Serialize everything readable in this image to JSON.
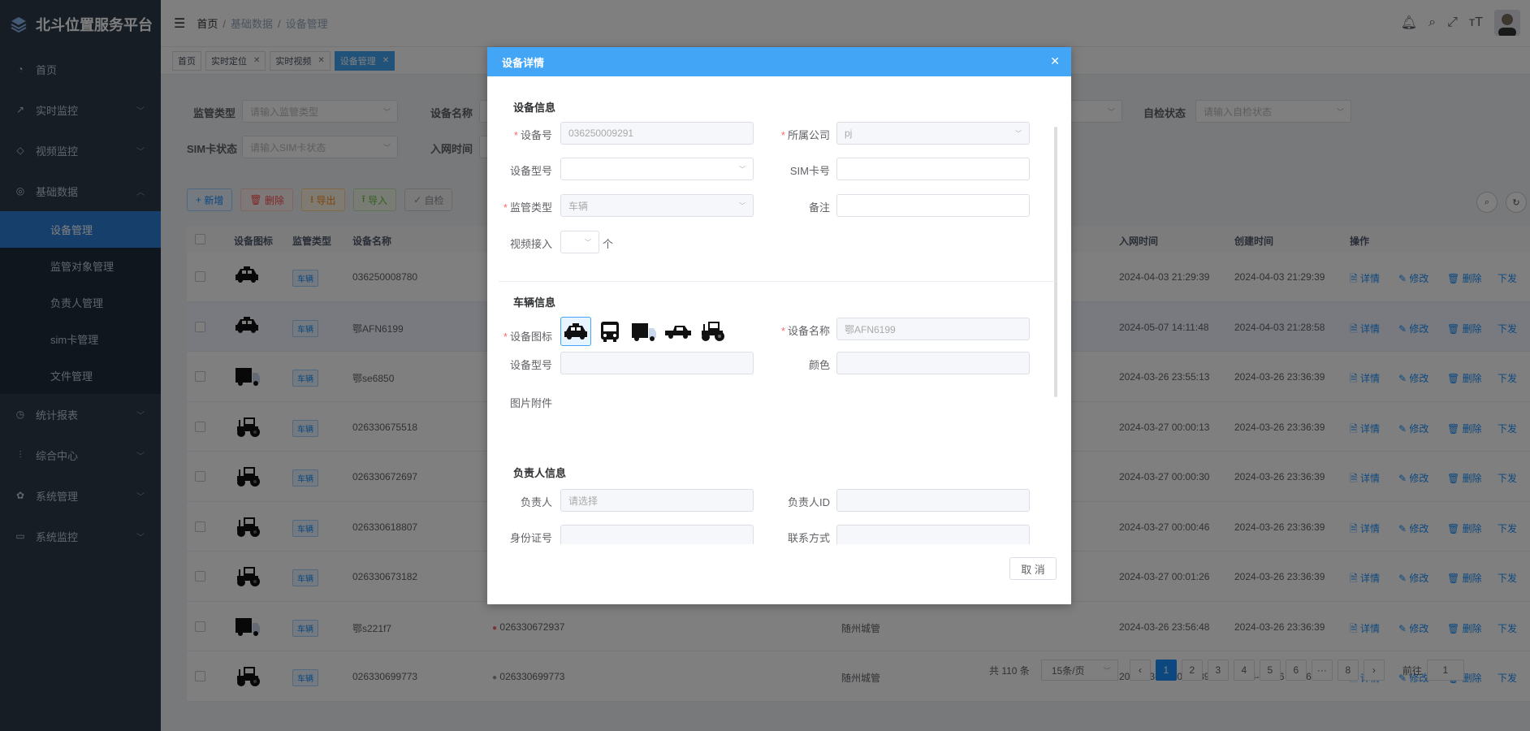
{
  "app": {
    "title": "北斗位置服务平台"
  },
  "sidebar": {
    "items": [
      {
        "label": "首页",
        "icon": "dashboard-icon"
      },
      {
        "label": "实时监控",
        "icon": "chart-line-icon"
      },
      {
        "label": "视频监控",
        "icon": "video-icon"
      },
      {
        "label": "基础数据",
        "icon": "database-icon"
      },
      {
        "label": "统计报表",
        "icon": "pie-chart-icon"
      },
      {
        "label": "综合中心",
        "icon": "sliders-icon"
      },
      {
        "label": "系统管理",
        "icon": "gear-icon"
      },
      {
        "label": "系统监控",
        "icon": "monitor-icon"
      }
    ],
    "sub_items": [
      "设备管理",
      "监管对象管理",
      "负责人管理",
      "sim卡管理",
      "文件管理"
    ]
  },
  "breadcrumb": [
    "首页",
    "基础数据",
    "设备管理"
  ],
  "tags": [
    {
      "label": "首页",
      "closable": false
    },
    {
      "label": "实时定位",
      "closable": true
    },
    {
      "label": "实时视频",
      "closable": true
    },
    {
      "label": "设备管理",
      "closable": true,
      "active": true
    }
  ],
  "filters": {
    "supervise_type_label": "监管类型",
    "supervise_type_placeholder": "请输入监管类型",
    "device_name_label": "设备名称",
    "self_check_label": "自检状态",
    "self_check_placeholder": "请输入自检状态",
    "sim_status_label": "SIM卡状态",
    "sim_status_placeholder": "请输入SIM卡状态",
    "network_time_label": "入网时间"
  },
  "toolbar": {
    "add": "新增",
    "delete": "删除",
    "export": "导出",
    "import": "导入",
    "selfcheck": "自检"
  },
  "table": {
    "headers": {
      "icon": "设备图标",
      "type": "监管类型",
      "name": "设备名称",
      "network_time": "入网时间",
      "created": "创建时间",
      "ops": "操作"
    },
    "ops": {
      "detail": "详情",
      "edit": "修改",
      "delete": "删除",
      "dispatch": "下发"
    },
    "rows": [
      {
        "icon": "taxi",
        "type": "车辆",
        "name": "036250008780",
        "device": "",
        "company": "",
        "network_time": "2024-04-03 21:29:39",
        "created": "2024-04-03 21:29:39"
      },
      {
        "icon": "taxi",
        "type": "车辆",
        "name": "鄂AFN6199",
        "device": "",
        "company": "",
        "network_time": "2024-05-07 14:11:48",
        "created": "2024-04-03 21:28:58"
      },
      {
        "icon": "truck",
        "type": "车辆",
        "name": "鄂se6850",
        "device": "",
        "company": "",
        "network_time": "2024-03-26 23:55:13",
        "created": "2024-03-26 23:36:39"
      },
      {
        "icon": "tractor",
        "type": "车辆",
        "name": "026330675518",
        "device": "",
        "company": "",
        "network_time": "2024-03-27 00:00:13",
        "created": "2024-03-26 23:36:39"
      },
      {
        "icon": "tractor",
        "type": "车辆",
        "name": "026330672697",
        "device": "",
        "company": "",
        "network_time": "2024-03-27 00:00:30",
        "created": "2024-03-26 23:36:39"
      },
      {
        "icon": "tractor",
        "type": "车辆",
        "name": "026330618807",
        "device": "",
        "company": "",
        "network_time": "2024-03-27 00:00:46",
        "created": "2024-03-26 23:36:39"
      },
      {
        "icon": "tractor",
        "type": "车辆",
        "name": "026330673182",
        "device": "",
        "company": "",
        "network_time": "2024-03-27 00:01:26",
        "created": "2024-03-26 23:36:39"
      },
      {
        "icon": "truck",
        "type": "车辆",
        "name": "鄂s221f7",
        "device": "026330672937",
        "company": "随州城管",
        "network_time": "2024-03-26 23:56:48",
        "created": "2024-03-26 23:36:39"
      },
      {
        "icon": "tractor",
        "type": "车辆",
        "name": "026330699773",
        "device": "026330699773",
        "company": "随州城管",
        "network_time": "2024-03-27 00:01:39",
        "created": "2024-03-26 23:36:39"
      }
    ]
  },
  "pagination": {
    "total": "共 110 条",
    "page_size": "15条/页",
    "pages": [
      "1",
      "2",
      "3",
      "4",
      "5",
      "6",
      "···",
      "8"
    ],
    "goto": "前往",
    "goto_value": "1"
  },
  "dialog": {
    "title": "设备详情",
    "device_section": "设备信息",
    "device_no_label": "设备号",
    "device_no_value": "036250009291",
    "company_label": "所属公司",
    "company_value": "pj",
    "device_model_label": "设备型号",
    "sim_label": "SIM卡号",
    "supervise_type_label": "监管类型",
    "supervise_type_value": "车辆",
    "remark_label": "备注",
    "video_label": "视频接入",
    "video_unit": "个",
    "vehicle_section": "车辆信息",
    "device_icon_label": "设备图标",
    "device_name_label": "设备名称",
    "device_name_value": "鄂AFN6199",
    "vehicle_model_label": "设备型号",
    "color_label": "颜色",
    "attachment_label": "图片附件",
    "owner_section": "负责人信息",
    "owner_label": "负责人",
    "owner_placeholder": "请选择",
    "owner_id_label": "负责人ID",
    "id_card_label": "身份证号",
    "contact_label": "联系方式",
    "cancel": "取 消"
  }
}
